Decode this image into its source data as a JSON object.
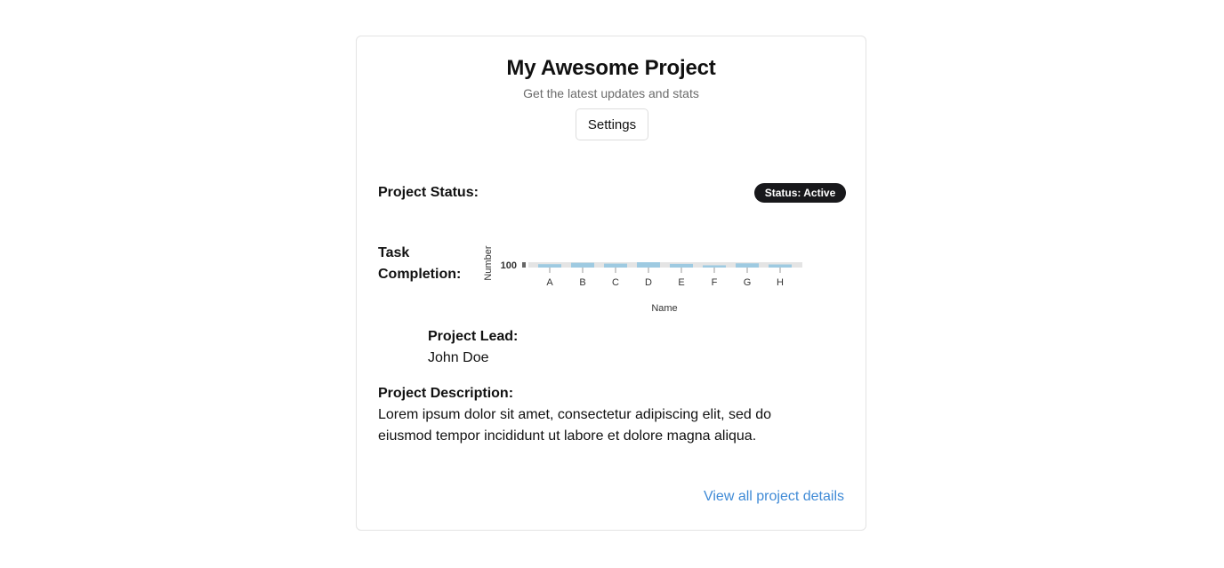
{
  "header": {
    "title": "My Awesome Project",
    "subtitle": "Get the latest updates and stats",
    "settings_label": "Settings"
  },
  "status": {
    "label": "Project Status:",
    "badge": "Status: Active",
    "badge_color": "#18181b"
  },
  "task": {
    "label_line1": "Task",
    "label_line2": "Completion:"
  },
  "chart_data": {
    "type": "bar",
    "categories": [
      "A",
      "B",
      "C",
      "D",
      "E",
      "F",
      "G",
      "H"
    ],
    "values": [
      60,
      85,
      70,
      95,
      65,
      40,
      75,
      55
    ],
    "xlabel": "Name",
    "ylabel": "Number",
    "ytick_label": "100",
    "bar_color": "#9ecae1",
    "grid": false
  },
  "lead": {
    "label": "Project Lead:",
    "name": "John Doe"
  },
  "description": {
    "label": "Project Description:",
    "text": "Lorem ipsum dolor sit amet, consectetur adipiscing elit, sed do eiusmod tempor incididunt ut labore et dolore magna aliqua."
  },
  "footer": {
    "link_label": "View all project details",
    "link_color": "#3f8ad6"
  }
}
